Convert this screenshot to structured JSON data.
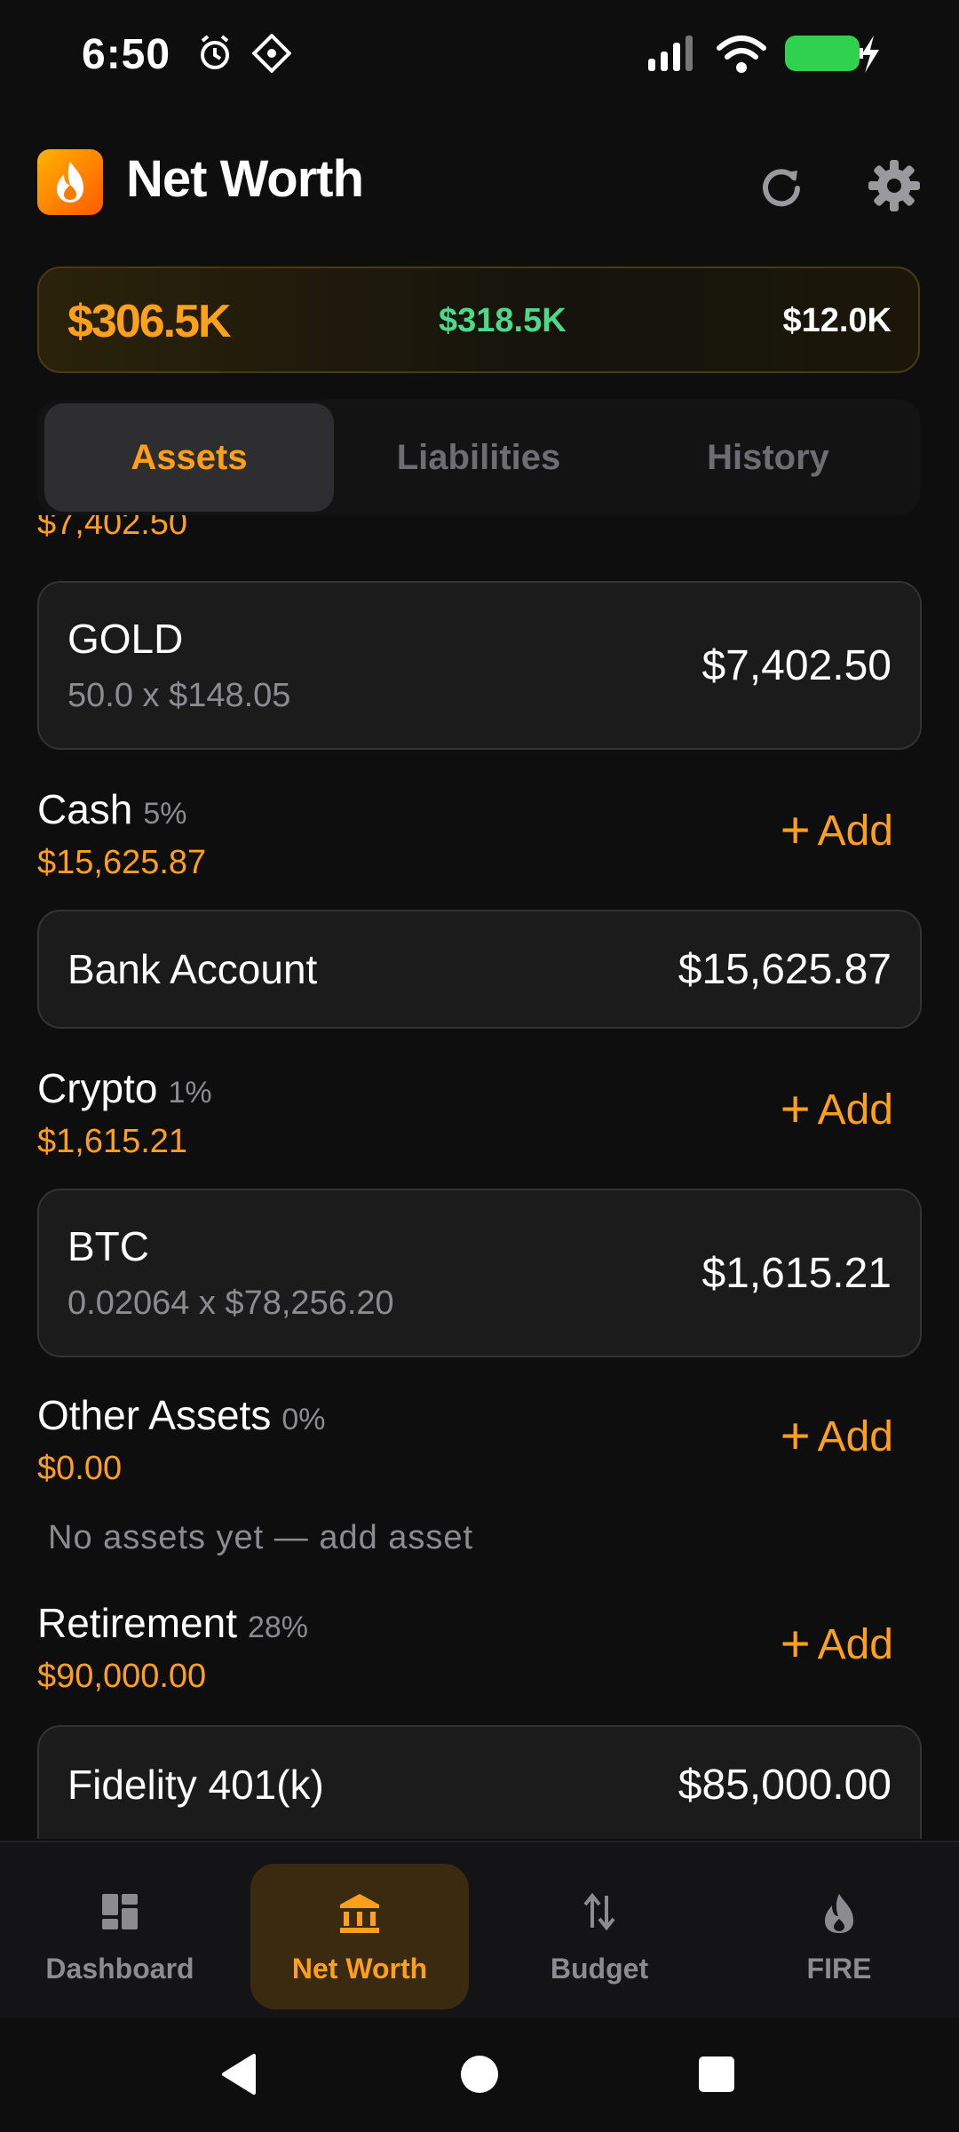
{
  "status_bar": {
    "time": "6:50"
  },
  "header": {
    "title": "Net Worth"
  },
  "summary": {
    "net_worth": "$306.5K",
    "assets": "$318.5K",
    "liabilities": "$12.0K"
  },
  "tabs": [
    {
      "label": "Assets",
      "active": true
    },
    {
      "label": "Liabilities",
      "active": false
    },
    {
      "label": "History",
      "active": false
    }
  ],
  "partial_total": "$7,402.50",
  "gold": {
    "name": "GOLD",
    "detail": "50.0 x $148.05",
    "value": "$7,402.50"
  },
  "sections": {
    "cash": {
      "title": "Cash",
      "pct": "5%",
      "total": "$15,625.87",
      "add": "Add",
      "item": {
        "name": "Bank Account",
        "value": "$15,625.87"
      }
    },
    "crypto": {
      "title": "Crypto",
      "pct": "1%",
      "total": "$1,615.21",
      "add": "Add",
      "item": {
        "name": "BTC",
        "detail": "0.02064 x $78,256.20",
        "value": "$1,615.21"
      }
    },
    "other": {
      "title": "Other Assets",
      "pct": "0%",
      "total": "$0.00",
      "add": "Add",
      "empty": "No assets yet — add asset"
    },
    "retirement": {
      "title": "Retirement",
      "pct": "28%",
      "total": "$90,000.00",
      "add": "Add",
      "item": {
        "name": "Fidelity 401(k)",
        "value": "$85,000.00"
      }
    }
  },
  "bottom_nav": [
    {
      "label": "Dashboard",
      "icon": "dashboard-icon",
      "active": false
    },
    {
      "label": "Net Worth",
      "icon": "bank-icon",
      "active": true
    },
    {
      "label": "Budget",
      "icon": "swap-vertical-icon",
      "active": false
    },
    {
      "label": "FIRE",
      "icon": "flame-icon",
      "active": false
    }
  ],
  "colors": {
    "accent": "#ff9f1a",
    "positive": "#4cd98a",
    "background": "#0e0e0f",
    "card": "#1b1b1c"
  }
}
